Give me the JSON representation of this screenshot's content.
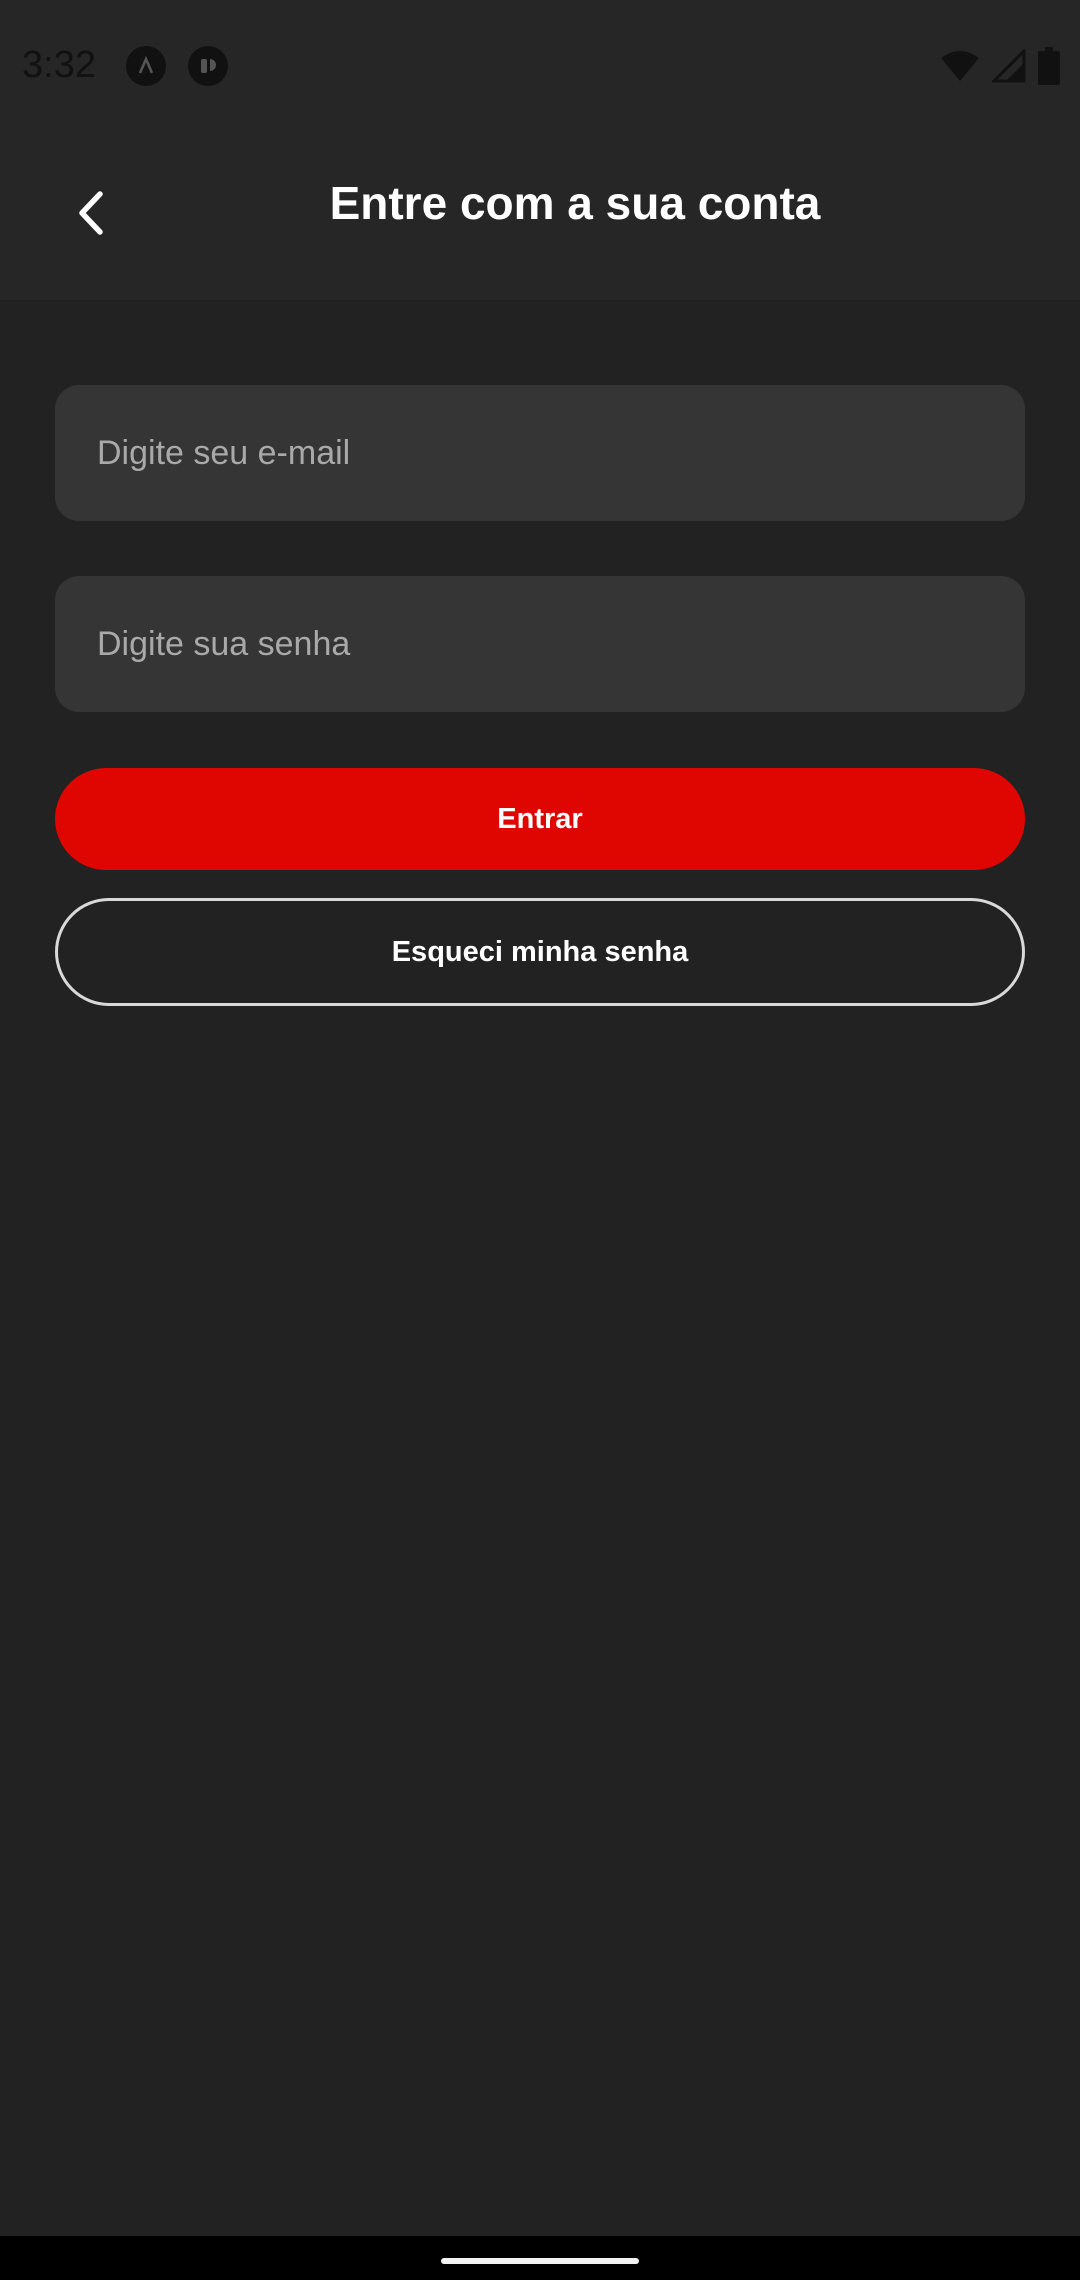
{
  "status_bar": {
    "time": "3:32",
    "icons": [
      "app-notification-icon",
      "app-notification-icon-2",
      "wifi-icon",
      "cell-signal-icon",
      "battery-icon"
    ]
  },
  "header": {
    "title": "Entre com a sua conta",
    "back_icon": "chevron-left-icon"
  },
  "form": {
    "email_placeholder": "Digite seu e-mail",
    "password_placeholder": "Digite sua senha",
    "submit_label": "Entrar",
    "forgot_label": "Esqueci minha senha"
  },
  "colors": {
    "background": "#222222",
    "header": "#262626",
    "field": "#353535",
    "accent": "#df0500"
  }
}
